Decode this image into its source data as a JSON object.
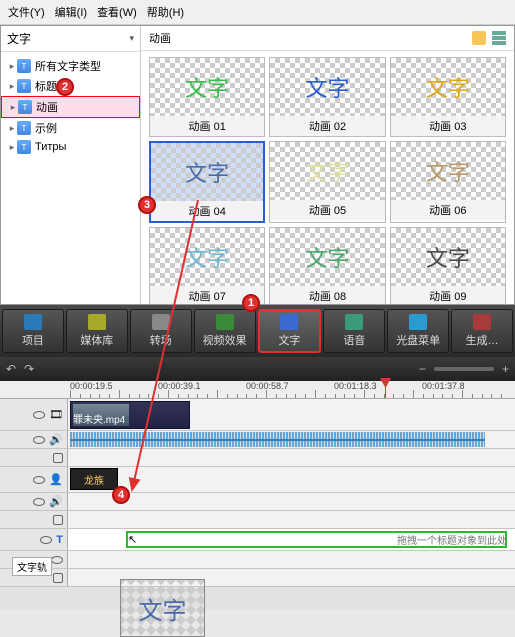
{
  "menu": {
    "file": "文件(Y)",
    "edit": "编辑(I)",
    "view": "查看(W)",
    "help": "帮助(H)"
  },
  "sidebar": {
    "header": "文字",
    "items": [
      {
        "label": "所有文字类型"
      },
      {
        "label": "标题"
      },
      {
        "label": "动画",
        "selected": true
      },
      {
        "label": "示例"
      },
      {
        "label": "Титры"
      }
    ]
  },
  "main": {
    "header": "动画",
    "thumbs": [
      {
        "label": "动画 01",
        "color": "#35c04a"
      },
      {
        "label": "动画 02",
        "color": "#2a5fcf"
      },
      {
        "label": "动画 03",
        "color": "#e0a810"
      },
      {
        "label": "动画 04",
        "color": "#4a6aa8",
        "selected": true
      },
      {
        "label": "动画 05",
        "color": "#e0e0a0"
      },
      {
        "label": "动画 06",
        "color": "#b89a6a"
      },
      {
        "label": "动画 07",
        "color": "#6ab8d0"
      },
      {
        "label": "动画 08",
        "color": "#4aa86a"
      },
      {
        "label": "动画 09",
        "color": "#4a4a4a"
      }
    ],
    "preview_text": "文字"
  },
  "toolbar": {
    "items": [
      {
        "label": "项目",
        "icon": "#2a7ab8"
      },
      {
        "label": "媒体库",
        "icon": "#a8a82a"
      },
      {
        "label": "转场",
        "icon": "#888"
      },
      {
        "label": "视频效果",
        "icon": "#3a8a3a"
      },
      {
        "label": "文字",
        "icon": "#3a6ad0",
        "active": true
      },
      {
        "label": "语音",
        "icon": "#3a9a7a"
      },
      {
        "label": "光盘菜单",
        "icon": "#2a9ad0"
      },
      {
        "label": "生成…",
        "icon": "#a83a3a"
      }
    ]
  },
  "timeline": {
    "marks": [
      "00:00:19.5",
      "00:00:39.1",
      "00:00:58.7",
      "00:01:18.3",
      "00:01:37.8"
    ],
    "video_clip": "罪未央.mp4",
    "overlay_clip": "龙族",
    "title_hint": "拖拽一个标题对象到此处",
    "text_track_label": "文字轨"
  },
  "drag_preview": "文字",
  "markers": {
    "m1": "1",
    "m2": "2",
    "m3": "3",
    "m4": "4"
  }
}
